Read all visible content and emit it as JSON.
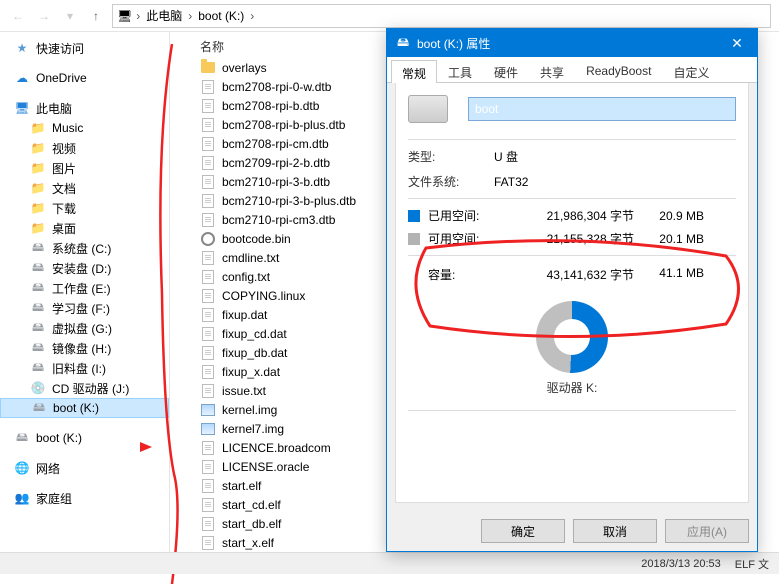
{
  "address": {
    "seg1": "此电脑",
    "seg2": "boot (K:)"
  },
  "sidebar": {
    "quick": "快速访问",
    "onedrive": "OneDrive",
    "thispc": "此电脑",
    "music": "Music",
    "videos": "视频",
    "pictures": "图片",
    "documents": "文档",
    "downloads": "下载",
    "desktop": "桌面",
    "sysdisk": "系统盘 (C:)",
    "installdisk": "安装盘 (D:)",
    "workdisk": "工作盘 (E:)",
    "studydisk": "学习盘 (F:)",
    "vmdisk": "虚拟盘 (G:)",
    "imgdisk": "镜像盘 (H:)",
    "olddisk": "旧料盘 (I:)",
    "cddrive": "CD 驱动器 (J:)",
    "bootk": "boot (K:)",
    "bootk2": "boot (K:)",
    "network": "网络",
    "homegroup": "家庭组"
  },
  "column_name": "名称",
  "files": [
    "overlays",
    "bcm2708-rpi-0-w.dtb",
    "bcm2708-rpi-b.dtb",
    "bcm2708-rpi-b-plus.dtb",
    "bcm2708-rpi-cm.dtb",
    "bcm2709-rpi-2-b.dtb",
    "bcm2710-rpi-3-b.dtb",
    "bcm2710-rpi-3-b-plus.dtb",
    "bcm2710-rpi-cm3.dtb",
    "bootcode.bin",
    "cmdline.txt",
    "config.txt",
    "COPYING.linux",
    "fixup.dat",
    "fixup_cd.dat",
    "fixup_db.dat",
    "fixup_x.dat",
    "issue.txt",
    "kernel.img",
    "kernel7.img",
    "LICENCE.broadcom",
    "LICENSE.oracle",
    "start.elf",
    "start_cd.elf",
    "start_db.elf",
    "start_x.elf"
  ],
  "status": {
    "datetime": "2018/3/13 20:53",
    "type": "ELF 文"
  },
  "props": {
    "title": "boot (K:) 属性",
    "tabs": {
      "general": "常规",
      "tools": "工具",
      "hardware": "硬件",
      "sharing": "共享",
      "readyboost": "ReadyBoost",
      "custom": "自定义"
    },
    "name_value": "boot",
    "type_label": "类型:",
    "type_value": "U 盘",
    "fs_label": "文件系统:",
    "fs_value": "FAT32",
    "used_label": "已用空间:",
    "used_bytes": "21,986,304 字节",
    "used_mb": "20.9 MB",
    "free_label": "可用空间:",
    "free_bytes": "21,155,328 字节",
    "free_mb": "20.1 MB",
    "cap_label": "容量:",
    "cap_bytes": "43,141,632 字节",
    "cap_mb": "41.1 MB",
    "drive_label": "驱动器 K:",
    "ok": "确定",
    "cancel": "取消",
    "apply": "应用(A)"
  },
  "chart_data": {
    "type": "pie",
    "title": "驱动器 K:",
    "series": [
      {
        "name": "已用空间",
        "value": 21986304,
        "display": "20.9 MB",
        "color": "#0078d7"
      },
      {
        "name": "可用空间",
        "value": 21155328,
        "display": "20.1 MB",
        "color": "#bfbfbf"
      }
    ],
    "total": {
      "label": "容量",
      "value": 43141632,
      "display": "41.1 MB"
    }
  }
}
